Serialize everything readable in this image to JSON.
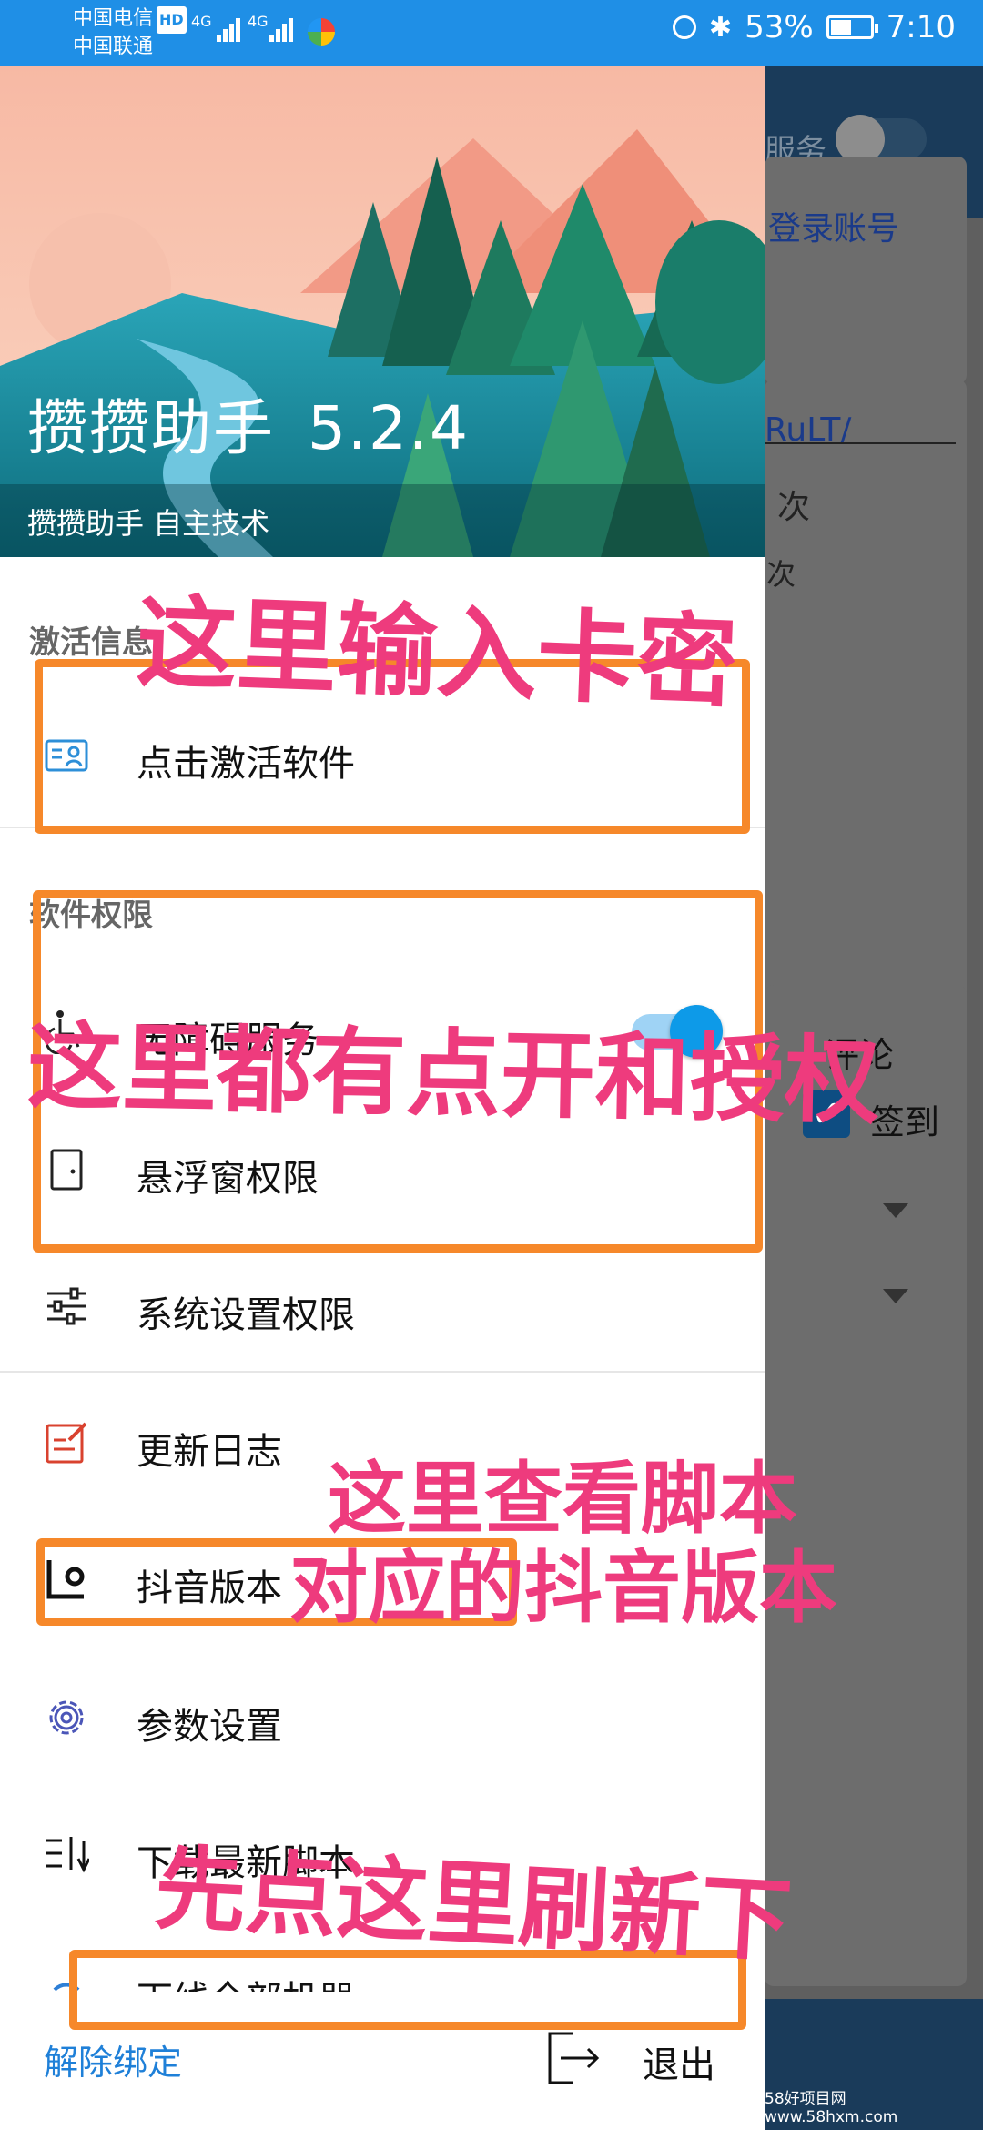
{
  "status_bar": {
    "carrier_1": "中国电信",
    "carrier_1_badge": "HD",
    "carrier_2": "中国联通",
    "network": "4G",
    "network_2": "4G",
    "battery_percent_text": "53%",
    "battery_level": 0.53,
    "time": "7:10"
  },
  "background_app": {
    "service_label": "服务",
    "login_text": "登录账号",
    "input_text": "RuLT/",
    "count_text": "次",
    "count_text_2": "次",
    "comment_label": "评论",
    "signin_label": "签到",
    "watermark": "58好项目网www.58hxm.com"
  },
  "drawer": {
    "app_name": "攒攒助手",
    "app_version": "5.2.4",
    "app_subtitle": "攒攒助手 自主技术",
    "section_activation": "激活信息",
    "activate_label": "点击激活软件",
    "section_permissions": "软件权限",
    "accessibility_label": "无障碍服务",
    "accessibility_enabled": true,
    "overlay_label": "悬浮窗权限",
    "system_settings_label": "系统设置权限",
    "changelog_label": "更新日志",
    "douyin_version_label": "抖音版本",
    "params_label": "参数设置",
    "download_scripts_label": "下载最新脚本",
    "offline_all_label": "下线全部机器",
    "unbind_label": "解除绑定",
    "exit_label": "退出"
  },
  "annotations": {
    "note_card": "这里输入卡密",
    "note_permissions": "这里都有点开和授权",
    "note_version_1": "这里查看脚本",
    "note_version_2": "对应的抖音版本",
    "note_refresh": "先点这里刷新下",
    "color_text": "#ee3b7d",
    "color_box": "#f6882a"
  },
  "colors": {
    "status_bar": "#1f8fe6",
    "accent_blue": "#0d9ae8",
    "link_blue": "#1f80d8",
    "icon_red": "#d9422f",
    "icon_purple": "#4b56b8"
  }
}
